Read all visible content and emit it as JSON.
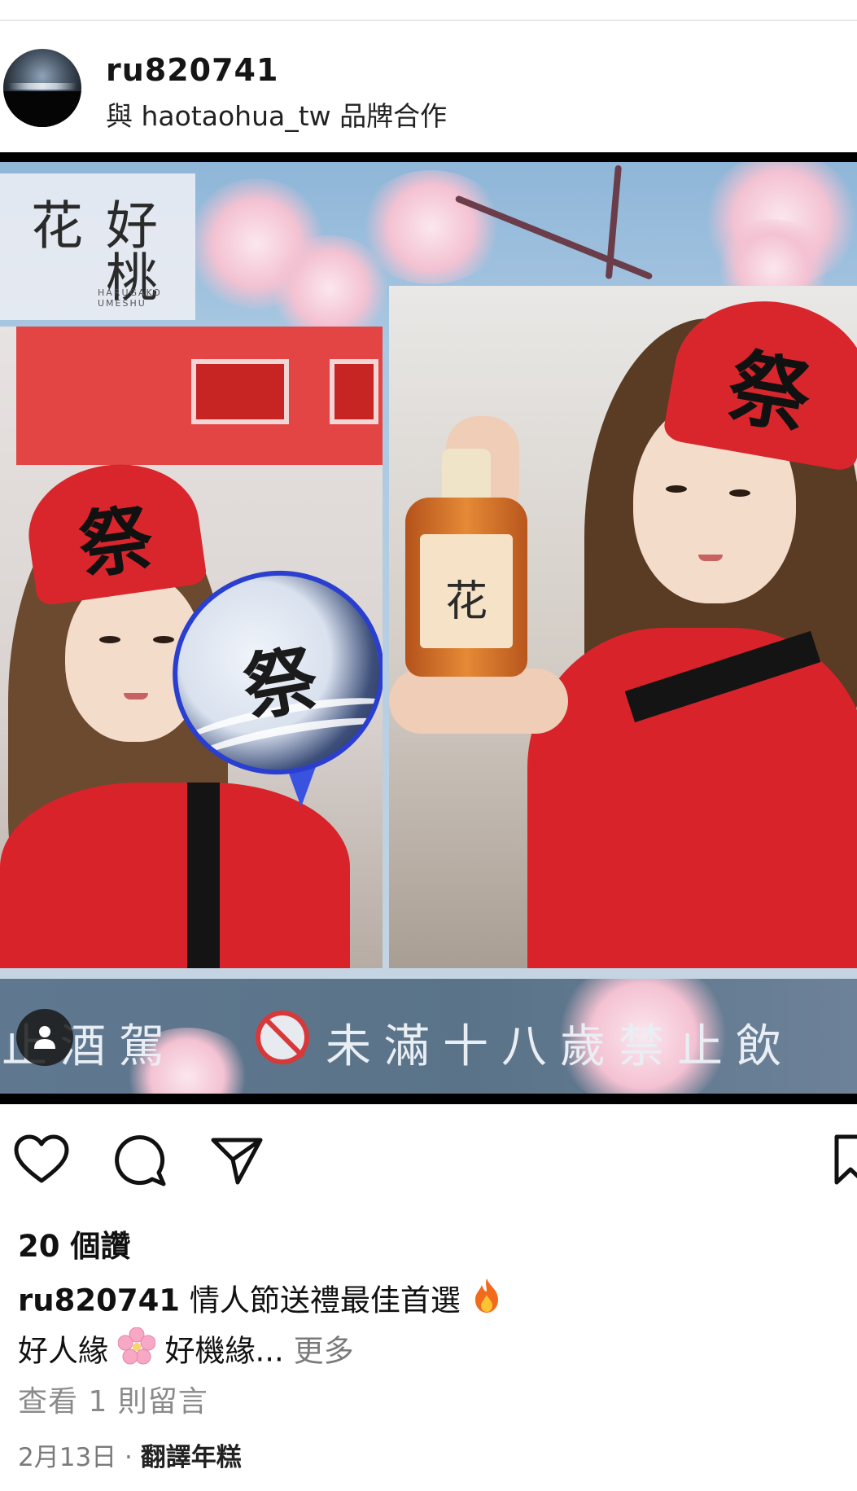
{
  "post": {
    "username": "ru820741",
    "partnership": "與 haotaohua_tw 品牌合作",
    "avatar_icon": "night-landscape-avatar",
    "image": {
      "brand_name": "好桃花",
      "brand_small": "HARUGAKO UMESHU",
      "headband_mark": "祭",
      "fan_mark": "祭",
      "bottle_label": "花",
      "banner_text_before": "禁止酒駕",
      "banner_text_after": "未滿十八歲禁止飲",
      "tag_icon": "person-tag-icon"
    },
    "actions": {
      "like_icon": "heart-icon",
      "comment_icon": "comment-icon",
      "share_icon": "send-icon",
      "save_icon": "bookmark-icon"
    },
    "likes": "20 個讚",
    "caption": {
      "user": "ru820741",
      "line1": "情人節送禮最佳首選",
      "line2a": "好人緣",
      "line2b": "好機緣...",
      "more": "更多"
    },
    "view_comments": "查看 1 則留言",
    "date": "2月13日",
    "separator": "·",
    "translate": "翻譯年糕",
    "colors": {
      "headband_red": "#d9262c",
      "fan_blue": "#2a3fd0",
      "muted_text": "#7a7a7a"
    }
  }
}
